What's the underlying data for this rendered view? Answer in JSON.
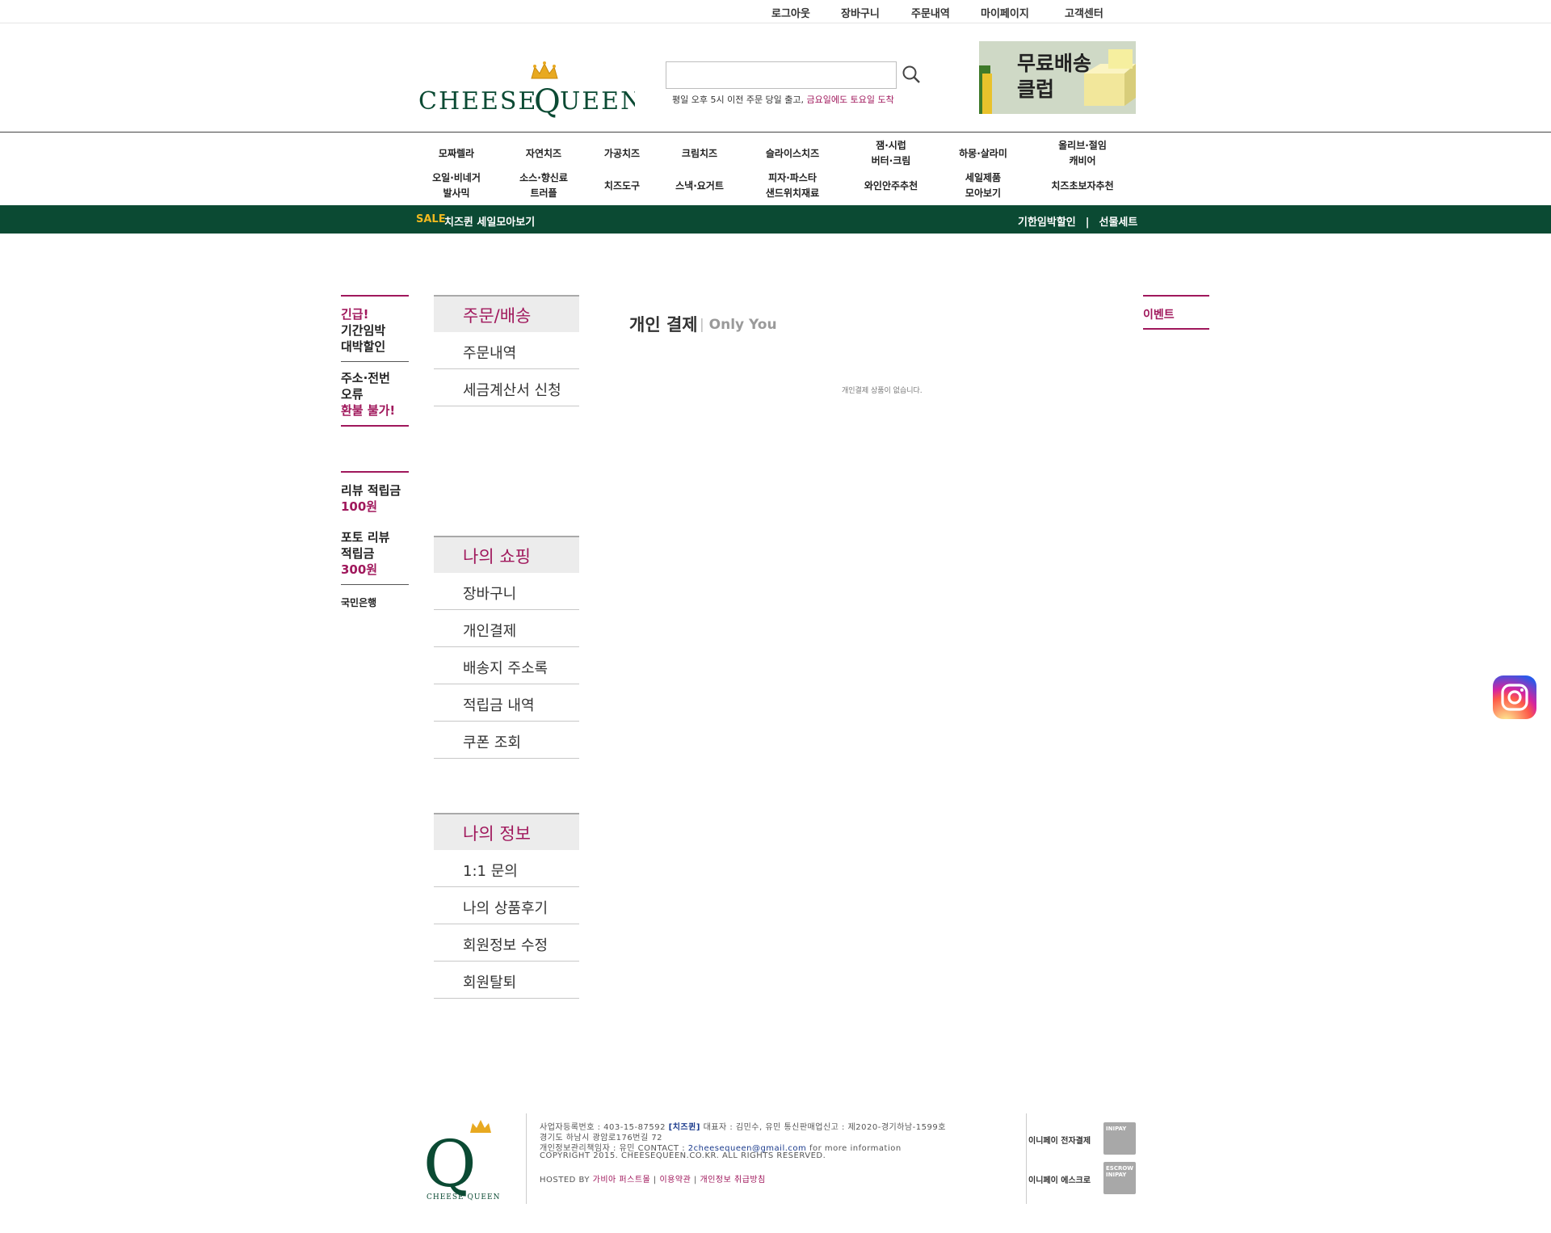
{
  "topbar": {
    "links": [
      "로그아웃",
      "장바구니",
      "주문내역",
      "마이페이지",
      "고객센터"
    ]
  },
  "header": {
    "logo_text": "CHEESE QUEEN",
    "search_placeholder": "",
    "notice_prefix": "평일 오후 5시 이전 주문 당일 출고, ",
    "notice_highlight": "금요일에도 토요일 도착",
    "banner_line1": "무료배송",
    "banner_line2": "클럽"
  },
  "categories": {
    "row1": [
      "모짜렐라",
      "자연치즈",
      "가공치즈",
      "크림치즈",
      "슬라이스치즈",
      "잼·시럽\n버터·크림",
      "하몽·살라미",
      "올리브·절임\n캐비어"
    ],
    "row2": [
      "오일·비네거\n발사믹",
      "소스·향신료\n트러플",
      "치즈도구",
      "스낵·요거트",
      "피자·파스타\n샌드위치재료",
      "와인안주추천",
      "세일제품\n모아보기",
      "치즈초보자추천"
    ]
  },
  "greenbar": {
    "sale_label": "SALE",
    "sale_text": "치즈퀸 세일모아보기",
    "right_link1": "기한임박할인",
    "separator": "|",
    "right_link2": "선물세트"
  },
  "sidenotes": {
    "block1_red": "긴급!",
    "block1_lines": [
      "기간임박",
      "대박할인"
    ],
    "block2_lines": [
      "주소·전번",
      "오류"
    ],
    "block2_red": "환불 불가!",
    "review_label": "리뷰 적립금",
    "review_amount": "100원",
    "photo_label1": "포토 리뷰",
    "photo_label2": "적립금",
    "photo_amount": "300원",
    "bank": "국민은행"
  },
  "menu": {
    "order_title": "주문/배송",
    "order_items": [
      "주문내역",
      "세금계산서 신청"
    ],
    "shopping_title": "나의 쇼핑",
    "shopping_items": [
      "장바구니",
      "개인결제",
      "배송지 주소록",
      "적립금 내역",
      "쿠폰 조회"
    ],
    "info_title": "나의 정보",
    "info_items": [
      "1:1 문의",
      "나의 상품후기",
      "회원정보 수정",
      "회원탈퇴"
    ]
  },
  "content": {
    "title": "개인 결제",
    "subtitle": "Only You",
    "empty_message": "개인결제 상품이 없습니다."
  },
  "right": {
    "event_label": "이벤트"
  },
  "footer": {
    "line1_a": "사업자등록번호 : 403-15-87592  ",
    "line1_brand": "[치즈퀸]",
    "line1_b": " 대표자 : 김민수, 유민 통신판매업신고 : 제2020-경기하남-1599호",
    "line2": "경기도 하남시 광암로176번길 72",
    "line3_a": "개인정보관리책임자 : 유민 CONTACT : ",
    "line3_email": "2cheesequeen@gmail.com",
    "line3_b": " for more information",
    "line4": "COPYRIGHT 2015. CHEESEQUEEN.CO.KR. ALL RIGHTS RESERVED.",
    "hosted_prefix": "HOSTED BY ",
    "hosted_by": "가비아 퍼스트몰",
    "terms": "이용약관",
    "privacy": "개인정보 취급방침",
    "pay1": "이니페이 전자결제",
    "pay2": "이니페이 에스크로",
    "badge1": "INIPAY",
    "badge2": "ESCROW\nINIPAY",
    "logo_caption": "CHEESE QUEEN"
  },
  "colors": {
    "brand_green": "#0b4a33",
    "accent": "#a0185c",
    "sale_yellow": "#f0b91f"
  }
}
